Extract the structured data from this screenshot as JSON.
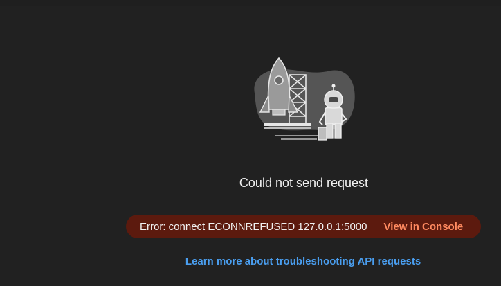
{
  "main": {
    "message": "Could not send request",
    "error": {
      "text": "Error: connect ECONNREFUSED 127.0.0.1:5000",
      "action_label": "View in Console"
    },
    "help_link": "Learn more about troubleshooting API requests"
  },
  "illustration": {
    "icon": "rocket-astronaut-illustration"
  },
  "colors": {
    "background": "#212121",
    "error_pill": "#5c1a0e",
    "error_action": "#ff8a60",
    "link": "#4a9eef"
  }
}
